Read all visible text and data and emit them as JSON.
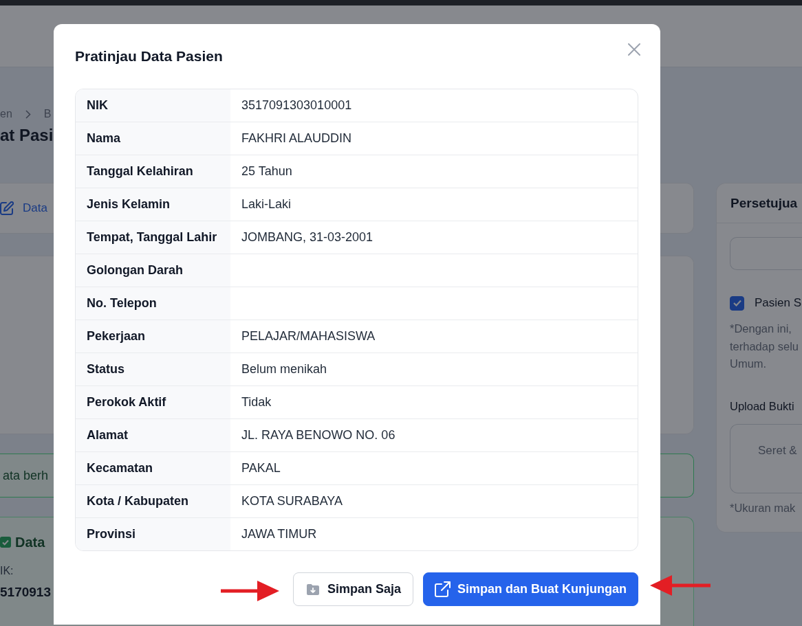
{
  "background_page": {
    "breadcrumb": [
      "en",
      "B"
    ],
    "title": "at Pasi",
    "tab": {
      "label": "Data",
      "selected": true
    },
    "alert": {
      "text": "ata berh"
    },
    "result_card": {
      "title": "Data",
      "field_label": "IK:",
      "field_value": "5170913"
    },
    "consent_card": {
      "title": "Persetujua",
      "checkbox": {
        "label": "Pasien S",
        "checked": true
      },
      "note_lines": [
        "*Dengan ini,",
        "terhadap selu",
        "Umum."
      ],
      "upload_label": "Upload Bukti",
      "dropzone_text": "Seret &",
      "size_note": "*Ukuran mak"
    }
  },
  "dialog": {
    "title": "Pratinjau Data Pasien",
    "rows": [
      {
        "label": "NIK",
        "value": "3517091303010001"
      },
      {
        "label": "Nama",
        "value": "FAKHRI ALAUDDIN"
      },
      {
        "label": "Tanggal Kelahiran",
        "value": "25 Tahun"
      },
      {
        "label": "Jenis Kelamin",
        "value": "Laki-Laki"
      },
      {
        "label": "Tempat, Tanggal Lahir",
        "value": "JOMBANG, 31-03-2001"
      },
      {
        "label": "Golongan Darah"
      },
      {
        "label": "No. Telepon"
      },
      {
        "label": "Pekerjaan",
        "value": "PELAJAR/MAHASISWA"
      },
      {
        "label": "Status",
        "value": "Belum menikah"
      },
      {
        "label": "Perokok Aktif",
        "value": "Tidak"
      },
      {
        "label": "Alamat",
        "value": "JL. RAYA BENOWO NO. 06"
      },
      {
        "label": "Kecamatan",
        "value": "PAKAL"
      },
      {
        "label": "Kota / Kabupaten",
        "value": "KOTA SURABAYA"
      },
      {
        "label": "Provinsi",
        "value": "JAWA TIMUR"
      }
    ],
    "buttons": [
      {
        "kind": "secondary",
        "label": "Simpan Saja",
        "pointer": {
          "kind": "left"
        }
      },
      {
        "kind": "primary",
        "label": "Simpan dan Buat Kunjungan",
        "pointer": {
          "kind": "right"
        }
      }
    ]
  }
}
